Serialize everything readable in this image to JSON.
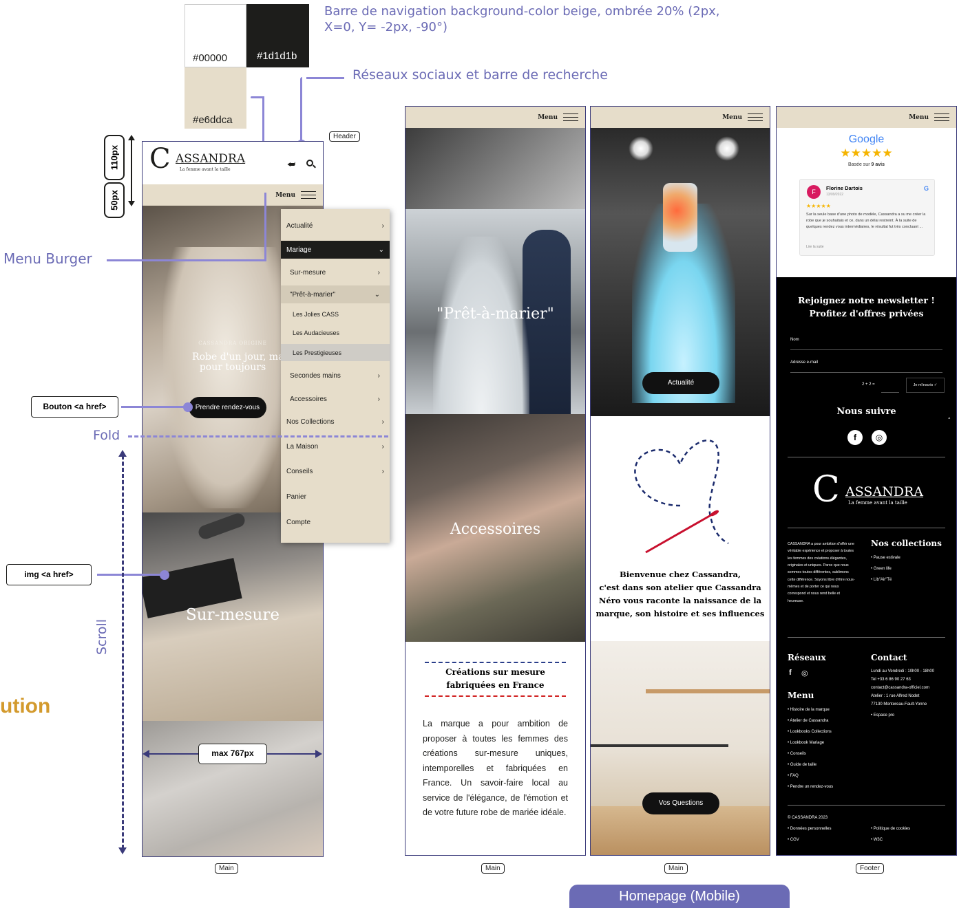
{
  "annotations": {
    "nav_note": "Barre de navigation background-color beige, ombrée 20% (2px, X=0, Y= -2px, -90°)",
    "social_note": "Réseaux sociaux et barre de recherche",
    "menu_burger": "Menu Burger",
    "button_href": "Bouton <a href>",
    "fold": "Fold",
    "img_href": "img <a href>",
    "scroll": "Scroll",
    "cut_text": "ution",
    "height_110": "110px",
    "height_50": "50px",
    "max_width": "max 767px",
    "homepage_label": "Homepage (Mobile)"
  },
  "swatches": [
    {
      "label": "#00000",
      "color": "#ffffff"
    },
    {
      "label": "#1d1d1b",
      "color": "#1d1d1b"
    },
    {
      "label": "#e6ddca",
      "color": "#e6ddca"
    }
  ],
  "tags": {
    "header": "Header",
    "main1": "Main",
    "main2": "Main",
    "main3": "Main",
    "footer": "Footer"
  },
  "phone1": {
    "logo_letter": "C",
    "logo_name": "ASSANDRA",
    "logo_tagline": "La femme avant la taille",
    "menu_label": "Menu",
    "hero_overline": "CASSANDRA ORIGINE",
    "hero_title_1": "Robe d'un jour, mai",
    "hero_title_2": "pour toujours",
    "cta": "Prendre rendez-vous",
    "sur_mesure": "Sur-mesure",
    "menu_items": [
      {
        "label": "Actualité",
        "chev": "›"
      },
      {
        "label": "Mariage",
        "chev": "⌄"
      },
      {
        "label": "Sur-mesure",
        "chev": "›"
      },
      {
        "label": "\"Prêt-à-marier\"",
        "chev": "⌄"
      },
      {
        "label": "Les Jolies CASS",
        "chev": ""
      },
      {
        "label": "Les Audacieuses",
        "chev": ""
      },
      {
        "label": "Les Prestigieuses",
        "chev": ""
      },
      {
        "label": "Secondes mains",
        "chev": "›"
      },
      {
        "label": "Accessoires",
        "chev": "›"
      },
      {
        "label": "Nos Collections",
        "chev": "›"
      },
      {
        "label": "La Maison",
        "chev": "›"
      },
      {
        "label": "Conseils",
        "chev": "›"
      },
      {
        "label": "Panier",
        "chev": ""
      },
      {
        "label": "Compte",
        "chev": ""
      }
    ]
  },
  "phone2": {
    "menu_label": "Menu",
    "pret": "\"Prêt-à-marier\"",
    "accessoires": "Accessoires",
    "creations_1": "Créations sur mesure",
    "creations_2": "fabriquées en France",
    "body": "La marque a pour ambition de proposer à toutes les femmes des créations sur-mesure uniques, intemporelles et fabriquées en France. Un savoir-faire local au service de l'élégance, de l'émotion et de votre future robe de mariée idéale."
  },
  "phone3": {
    "menu_label": "Menu",
    "actualite": "Actualité",
    "welcome_1": "Bienvenue chez Cassandra,",
    "welcome_2": "c'est dans son atelier que Cassandra",
    "welcome_3": "Néro vous raconte la naissance de la",
    "welcome_4": "marque, son histoire et ses influences",
    "questions": "Vos Questions"
  },
  "phone4": {
    "menu_label": "Menu",
    "google": "Google",
    "stars": "★★★★★",
    "based_prefix": "Basée sur",
    "based_count": "9 avis",
    "reviewer_initial": "F",
    "reviewer": "Florine Dartois",
    "review_date": "13/09/2022",
    "review_g": "G",
    "review_stars": "★★★★★",
    "review_text": "Sur la seule base d'une photo de modèle, Cassandra a su me créer la robe que je souhaitais et ce, dans un délai restreint. À la suite de quelques rendez vous intermédiaires, le résultat fut très concluant ...",
    "read_more": "Lire la suite",
    "newsletter_1": "Rejoignez notre newsletter !",
    "newsletter_2": "Profitez d'offres privées",
    "name_ph": "Nom",
    "email_ph": "Adresse e-mail",
    "captcha": "2 + 2 =",
    "subscribe": "Je m'inscris ✓",
    "follow": "Nous suivre",
    "fb": "f",
    "ig": "◎",
    "logo_letter": "C",
    "logo_name": "ASSANDRA",
    "logo_tagline": "La femme avant la taille",
    "about": "CASSANDRA a pour ambition d'offrir une véritable expérience et proposer à toutes les femmes des créations élégantes, originales et uniques. Parce que nous sommes toutes différentes, sublimons cette différence. Soyons libre d'être nous-mêmes et de porter ce qui nous correspond et nous rend belle et heureuse.",
    "collections_title": "Nos collections",
    "collections": [
      "• Pause estivale",
      "• Green life",
      "• Lib\"Air\"Té"
    ],
    "reseaux_title": "Réseaux",
    "contact_title": "Contact",
    "contact": [
      "Lundi au Vendredi : 10h00 - 18h00",
      "Tel +33 6 86 90 27 63",
      "contact@cassandra-officiel.com",
      "Atelier : 1 rue Alfred Nodet",
      "77130 Montereau-Fault-Yonne",
      "• Espace pro"
    ],
    "menu_title": "Menu",
    "menu_links": [
      "• Histoire de la marque",
      "• Atelier de Cassandra",
      "• Lookbooks Collections",
      "• Lookbook Mariage",
      "• Conseils",
      "• Guide de taille",
      "• FAQ",
      "• Pendre un rendez-vous"
    ],
    "copyright": "© CASSANDRA 2023",
    "legal_left": [
      "• Données personnelles",
      "• CGV"
    ],
    "legal_right": [
      "• Politique de cookies",
      "• W3C"
    ]
  }
}
